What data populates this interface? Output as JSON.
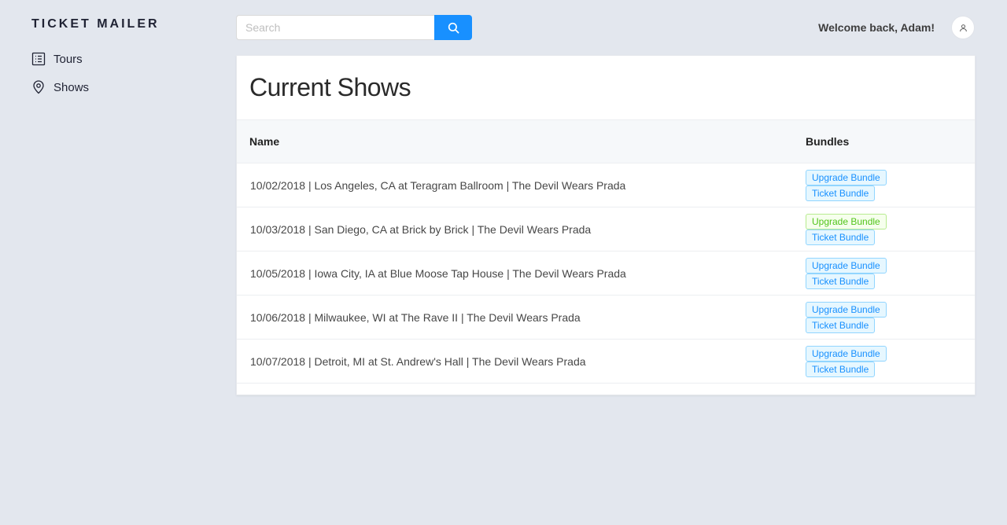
{
  "brand": "TICKET MAILER",
  "nav": [
    {
      "label": "Tours",
      "icon": "list-icon"
    },
    {
      "label": "Shows",
      "icon": "location-pin-icon"
    }
  ],
  "search": {
    "placeholder": "Search",
    "value": ""
  },
  "header": {
    "welcome": "Welcome back, Adam!"
  },
  "main": {
    "title": "Current Shows",
    "columns": {
      "name": "Name",
      "bundles": "Bundles"
    },
    "rows": [
      {
        "name": "10/02/2018 | Los Angeles, CA at Teragram Ballroom | The Devil Wears Prada",
        "bundles": [
          "Upgrade Bundle",
          "Ticket Bundle"
        ]
      },
      {
        "name": "10/03/2018 | San Diego, CA at Brick by Brick | The Devil Wears Prada",
        "bundles": [
          "Upgrade Bundle",
          "Ticket Bundle"
        ]
      },
      {
        "name": "10/05/2018 | Iowa City, IA at Blue Moose Tap House | The Devil Wears Prada",
        "bundles": [
          "Upgrade Bundle",
          "Ticket Bundle"
        ]
      },
      {
        "name": "10/06/2018 | Milwaukee, WI at The Rave II | The Devil Wears Prada",
        "bundles": [
          "Upgrade Bundle",
          "Ticket Bundle"
        ]
      },
      {
        "name": "10/07/2018 | Detroit, MI at St. Andrew's Hall | The Devil Wears Prada",
        "bundles": [
          "Upgrade Bundle",
          "Ticket Bundle"
        ]
      }
    ]
  },
  "colors": {
    "background": "#e3e7ee",
    "accent": "#1890ff",
    "tag_blue": "#1890ff",
    "tag_green": "#52c41a"
  }
}
